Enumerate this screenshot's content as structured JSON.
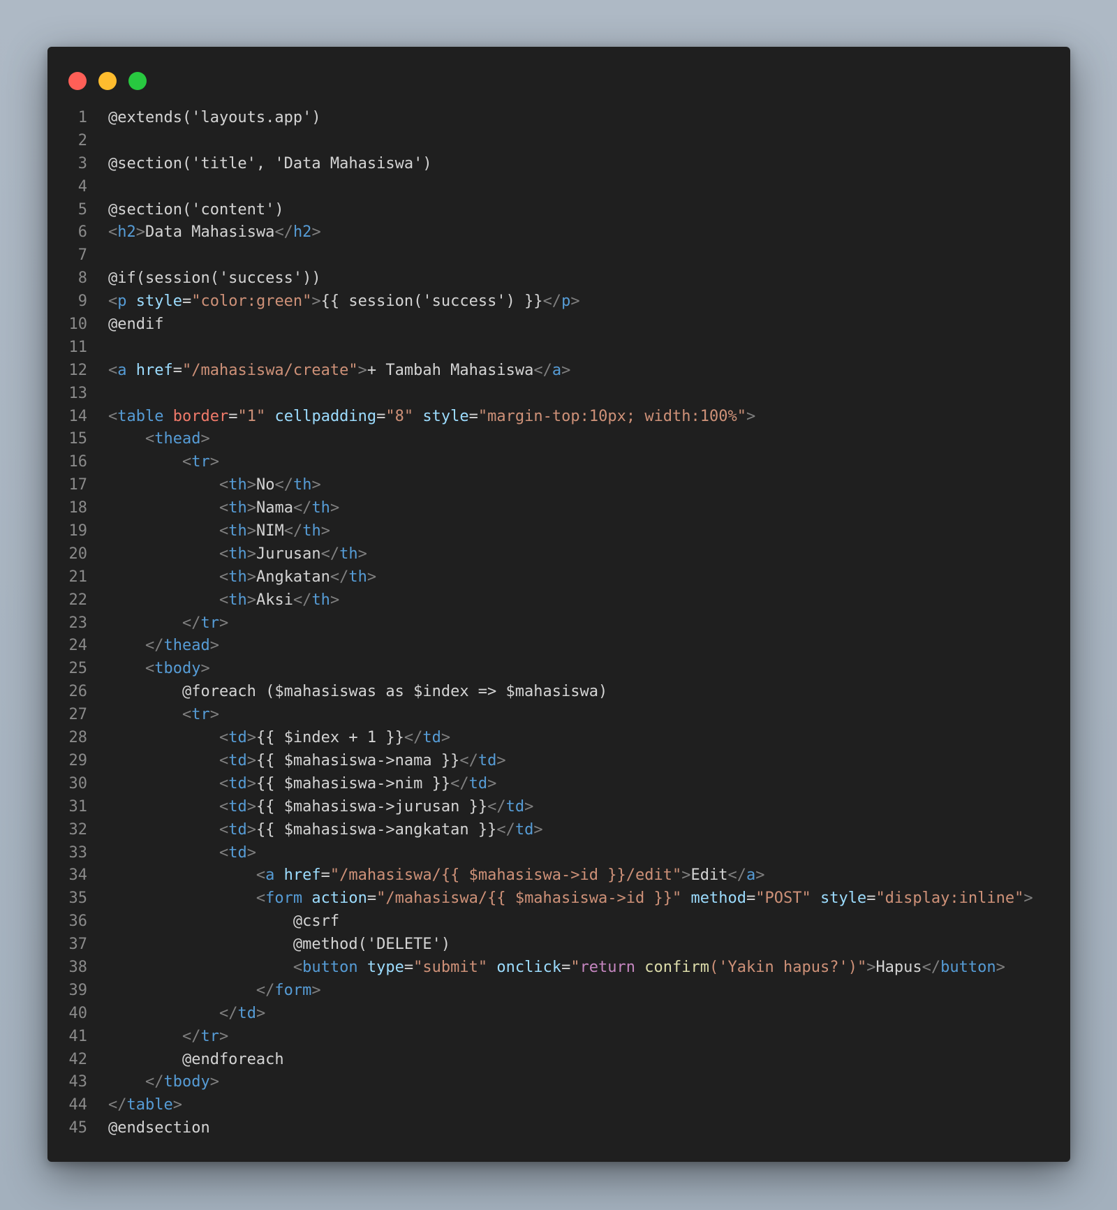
{
  "colors": {
    "background": "#a9b5c2",
    "editor_background": "#1f1f1f",
    "line_number": "#8a8a8a",
    "plain": "#d4d4d4",
    "bracket": "#808080",
    "tag": "#569cd6",
    "attribute": "#9cdcfe",
    "attribute_red": "#f07a6a",
    "string": "#ce9178",
    "keyword": "#c586c0",
    "function": "#dcdcaa",
    "close_button": "#ff5f57",
    "minimize_button": "#febc2e",
    "maximize_button": "#28c840"
  },
  "lines": [
    {
      "n": "1",
      "tokens": [
        [
          "plain",
          "@extends('layouts.app')"
        ]
      ]
    },
    {
      "n": "2",
      "tokens": []
    },
    {
      "n": "3",
      "tokens": [
        [
          "plain",
          "@section('title', 'Data Mahasiswa')"
        ]
      ]
    },
    {
      "n": "4",
      "tokens": []
    },
    {
      "n": "5",
      "tokens": [
        [
          "plain",
          "@section('content')"
        ]
      ]
    },
    {
      "n": "6",
      "tokens": [
        [
          "bracket",
          "<"
        ],
        [
          "tag",
          "h2"
        ],
        [
          "bracket",
          ">"
        ],
        [
          "plain",
          "Data Mahasiswa"
        ],
        [
          "bracket",
          "</"
        ],
        [
          "tag",
          "h2"
        ],
        [
          "bracket",
          ">"
        ]
      ]
    },
    {
      "n": "7",
      "tokens": []
    },
    {
      "n": "8",
      "tokens": [
        [
          "plain",
          "@if(session('success'))"
        ]
      ]
    },
    {
      "n": "9",
      "tokens": [
        [
          "bracket",
          "<"
        ],
        [
          "tag",
          "p"
        ],
        [
          "plain",
          " "
        ],
        [
          "attr",
          "style"
        ],
        [
          "plain",
          "="
        ],
        [
          "str",
          "\"color:green\""
        ],
        [
          "bracket",
          ">"
        ],
        [
          "plain",
          "{{ session('success') }}"
        ],
        [
          "bracket",
          "</"
        ],
        [
          "tag",
          "p"
        ],
        [
          "bracket",
          ">"
        ]
      ]
    },
    {
      "n": "10",
      "tokens": [
        [
          "plain",
          "@endif"
        ]
      ]
    },
    {
      "n": "11",
      "tokens": []
    },
    {
      "n": "12",
      "tokens": [
        [
          "bracket",
          "<"
        ],
        [
          "tag",
          "a"
        ],
        [
          "plain",
          " "
        ],
        [
          "attr",
          "href"
        ],
        [
          "plain",
          "="
        ],
        [
          "str",
          "\"/mahasiswa/create\""
        ],
        [
          "bracket",
          ">"
        ],
        [
          "plain",
          "+ Tambah Mahasiswa"
        ],
        [
          "bracket",
          "</"
        ],
        [
          "tag",
          "a"
        ],
        [
          "bracket",
          ">"
        ]
      ]
    },
    {
      "n": "13",
      "tokens": []
    },
    {
      "n": "14",
      "tokens": [
        [
          "bracket",
          "<"
        ],
        [
          "tag",
          "table"
        ],
        [
          "plain",
          " "
        ],
        [
          "attr-red",
          "border"
        ],
        [
          "plain",
          "="
        ],
        [
          "str",
          "\"1\""
        ],
        [
          "plain",
          " "
        ],
        [
          "attr",
          "cellpadding"
        ],
        [
          "plain",
          "="
        ],
        [
          "str",
          "\"8\""
        ],
        [
          "plain",
          " "
        ],
        [
          "attr",
          "style"
        ],
        [
          "plain",
          "="
        ],
        [
          "str",
          "\"margin-top:10px; width:100%\""
        ],
        [
          "bracket",
          ">"
        ]
      ]
    },
    {
      "n": "15",
      "tokens": [
        [
          "plain",
          "    "
        ],
        [
          "bracket",
          "<"
        ],
        [
          "tag",
          "thead"
        ],
        [
          "bracket",
          ">"
        ]
      ]
    },
    {
      "n": "16",
      "tokens": [
        [
          "plain",
          "        "
        ],
        [
          "bracket",
          "<"
        ],
        [
          "tag",
          "tr"
        ],
        [
          "bracket",
          ">"
        ]
      ]
    },
    {
      "n": "17",
      "tokens": [
        [
          "plain",
          "            "
        ],
        [
          "bracket",
          "<"
        ],
        [
          "tag",
          "th"
        ],
        [
          "bracket",
          ">"
        ],
        [
          "plain",
          "No"
        ],
        [
          "bracket",
          "</"
        ],
        [
          "tag",
          "th"
        ],
        [
          "bracket",
          ">"
        ]
      ]
    },
    {
      "n": "18",
      "tokens": [
        [
          "plain",
          "            "
        ],
        [
          "bracket",
          "<"
        ],
        [
          "tag",
          "th"
        ],
        [
          "bracket",
          ">"
        ],
        [
          "plain",
          "Nama"
        ],
        [
          "bracket",
          "</"
        ],
        [
          "tag",
          "th"
        ],
        [
          "bracket",
          ">"
        ]
      ]
    },
    {
      "n": "19",
      "tokens": [
        [
          "plain",
          "            "
        ],
        [
          "bracket",
          "<"
        ],
        [
          "tag",
          "th"
        ],
        [
          "bracket",
          ">"
        ],
        [
          "plain",
          "NIM"
        ],
        [
          "bracket",
          "</"
        ],
        [
          "tag",
          "th"
        ],
        [
          "bracket",
          ">"
        ]
      ]
    },
    {
      "n": "20",
      "tokens": [
        [
          "plain",
          "            "
        ],
        [
          "bracket",
          "<"
        ],
        [
          "tag",
          "th"
        ],
        [
          "bracket",
          ">"
        ],
        [
          "plain",
          "Jurusan"
        ],
        [
          "bracket",
          "</"
        ],
        [
          "tag",
          "th"
        ],
        [
          "bracket",
          ">"
        ]
      ]
    },
    {
      "n": "21",
      "tokens": [
        [
          "plain",
          "            "
        ],
        [
          "bracket",
          "<"
        ],
        [
          "tag",
          "th"
        ],
        [
          "bracket",
          ">"
        ],
        [
          "plain",
          "Angkatan"
        ],
        [
          "bracket",
          "</"
        ],
        [
          "tag",
          "th"
        ],
        [
          "bracket",
          ">"
        ]
      ]
    },
    {
      "n": "22",
      "tokens": [
        [
          "plain",
          "            "
        ],
        [
          "bracket",
          "<"
        ],
        [
          "tag",
          "th"
        ],
        [
          "bracket",
          ">"
        ],
        [
          "plain",
          "Aksi"
        ],
        [
          "bracket",
          "</"
        ],
        [
          "tag",
          "th"
        ],
        [
          "bracket",
          ">"
        ]
      ]
    },
    {
      "n": "23",
      "tokens": [
        [
          "plain",
          "        "
        ],
        [
          "bracket",
          "</"
        ],
        [
          "tag",
          "tr"
        ],
        [
          "bracket",
          ">"
        ]
      ]
    },
    {
      "n": "24",
      "tokens": [
        [
          "plain",
          "    "
        ],
        [
          "bracket",
          "</"
        ],
        [
          "tag",
          "thead"
        ],
        [
          "bracket",
          ">"
        ]
      ]
    },
    {
      "n": "25",
      "tokens": [
        [
          "plain",
          "    "
        ],
        [
          "bracket",
          "<"
        ],
        [
          "tag",
          "tbody"
        ],
        [
          "bracket",
          ">"
        ]
      ]
    },
    {
      "n": "26",
      "tokens": [
        [
          "plain",
          "        @foreach ($mahasiswas as $index => $mahasiswa)"
        ]
      ]
    },
    {
      "n": "27",
      "tokens": [
        [
          "plain",
          "        "
        ],
        [
          "bracket",
          "<"
        ],
        [
          "tag",
          "tr"
        ],
        [
          "bracket",
          ">"
        ]
      ]
    },
    {
      "n": "28",
      "tokens": [
        [
          "plain",
          "            "
        ],
        [
          "bracket",
          "<"
        ],
        [
          "tag",
          "td"
        ],
        [
          "bracket",
          ">"
        ],
        [
          "plain",
          "{{ $index + 1 }}"
        ],
        [
          "bracket",
          "</"
        ],
        [
          "tag",
          "td"
        ],
        [
          "bracket",
          ">"
        ]
      ]
    },
    {
      "n": "29",
      "tokens": [
        [
          "plain",
          "            "
        ],
        [
          "bracket",
          "<"
        ],
        [
          "tag",
          "td"
        ],
        [
          "bracket",
          ">"
        ],
        [
          "plain",
          "{{ $mahasiswa->nama }}"
        ],
        [
          "bracket",
          "</"
        ],
        [
          "tag",
          "td"
        ],
        [
          "bracket",
          ">"
        ]
      ]
    },
    {
      "n": "30",
      "tokens": [
        [
          "plain",
          "            "
        ],
        [
          "bracket",
          "<"
        ],
        [
          "tag",
          "td"
        ],
        [
          "bracket",
          ">"
        ],
        [
          "plain",
          "{{ $mahasiswa->nim }}"
        ],
        [
          "bracket",
          "</"
        ],
        [
          "tag",
          "td"
        ],
        [
          "bracket",
          ">"
        ]
      ]
    },
    {
      "n": "31",
      "tokens": [
        [
          "plain",
          "            "
        ],
        [
          "bracket",
          "<"
        ],
        [
          "tag",
          "td"
        ],
        [
          "bracket",
          ">"
        ],
        [
          "plain",
          "{{ $mahasiswa->jurusan }}"
        ],
        [
          "bracket",
          "</"
        ],
        [
          "tag",
          "td"
        ],
        [
          "bracket",
          ">"
        ]
      ]
    },
    {
      "n": "32",
      "tokens": [
        [
          "plain",
          "            "
        ],
        [
          "bracket",
          "<"
        ],
        [
          "tag",
          "td"
        ],
        [
          "bracket",
          ">"
        ],
        [
          "plain",
          "{{ $mahasiswa->angkatan }}"
        ],
        [
          "bracket",
          "</"
        ],
        [
          "tag",
          "td"
        ],
        [
          "bracket",
          ">"
        ]
      ]
    },
    {
      "n": "33",
      "tokens": [
        [
          "plain",
          "            "
        ],
        [
          "bracket",
          "<"
        ],
        [
          "tag",
          "td"
        ],
        [
          "bracket",
          ">"
        ]
      ]
    },
    {
      "n": "34",
      "tokens": [
        [
          "plain",
          "                "
        ],
        [
          "bracket",
          "<"
        ],
        [
          "tag",
          "a"
        ],
        [
          "plain",
          " "
        ],
        [
          "attr",
          "href"
        ],
        [
          "plain",
          "="
        ],
        [
          "str",
          "\"/mahasiswa/{{ $mahasiswa->id }}/edit\""
        ],
        [
          "bracket",
          ">"
        ],
        [
          "plain",
          "Edit"
        ],
        [
          "bracket",
          "</"
        ],
        [
          "tag",
          "a"
        ],
        [
          "bracket",
          ">"
        ]
      ]
    },
    {
      "n": "35",
      "tokens": [
        [
          "plain",
          "                "
        ],
        [
          "bracket",
          "<"
        ],
        [
          "tag",
          "form"
        ],
        [
          "plain",
          " "
        ],
        [
          "attr",
          "action"
        ],
        [
          "plain",
          "="
        ],
        [
          "str",
          "\"/mahasiswa/{{ $mahasiswa->id }}\""
        ],
        [
          "plain",
          " "
        ],
        [
          "attr",
          "method"
        ],
        [
          "plain",
          "="
        ],
        [
          "str",
          "\"POST\""
        ],
        [
          "plain",
          " "
        ],
        [
          "attr",
          "style"
        ],
        [
          "plain",
          "="
        ],
        [
          "str",
          "\"display:inline\""
        ],
        [
          "bracket",
          ">"
        ]
      ]
    },
    {
      "n": "36",
      "tokens": [
        [
          "plain",
          "                    @csrf"
        ]
      ]
    },
    {
      "n": "37",
      "tokens": [
        [
          "plain",
          "                    @method('DELETE')"
        ]
      ]
    },
    {
      "n": "38",
      "tokens": [
        [
          "plain",
          "                    "
        ],
        [
          "bracket",
          "<"
        ],
        [
          "tag",
          "button"
        ],
        [
          "plain",
          " "
        ],
        [
          "attr",
          "type"
        ],
        [
          "plain",
          "="
        ],
        [
          "str",
          "\"submit\""
        ],
        [
          "plain",
          " "
        ],
        [
          "attr",
          "onclick"
        ],
        [
          "plain",
          "="
        ],
        [
          "str",
          "\""
        ],
        [
          "kw",
          "return"
        ],
        [
          "plain",
          " "
        ],
        [
          "fn",
          "confirm"
        ],
        [
          "str",
          "('Yakin hapus?')\""
        ],
        [
          "bracket",
          ">"
        ],
        [
          "plain",
          "Hapus"
        ],
        [
          "bracket",
          "</"
        ],
        [
          "tag",
          "button"
        ],
        [
          "bracket",
          ">"
        ]
      ]
    },
    {
      "n": "39",
      "tokens": [
        [
          "plain",
          "                "
        ],
        [
          "bracket",
          "</"
        ],
        [
          "tag",
          "form"
        ],
        [
          "bracket",
          ">"
        ]
      ]
    },
    {
      "n": "40",
      "tokens": [
        [
          "plain",
          "            "
        ],
        [
          "bracket",
          "</"
        ],
        [
          "tag",
          "td"
        ],
        [
          "bracket",
          ">"
        ]
      ]
    },
    {
      "n": "41",
      "tokens": [
        [
          "plain",
          "        "
        ],
        [
          "bracket",
          "</"
        ],
        [
          "tag",
          "tr"
        ],
        [
          "bracket",
          ">"
        ]
      ]
    },
    {
      "n": "42",
      "tokens": [
        [
          "plain",
          "        @endforeach"
        ]
      ]
    },
    {
      "n": "43",
      "tokens": [
        [
          "plain",
          "    "
        ],
        [
          "bracket",
          "</"
        ],
        [
          "tag",
          "tbody"
        ],
        [
          "bracket",
          ">"
        ]
      ]
    },
    {
      "n": "44",
      "tokens": [
        [
          "bracket",
          "</"
        ],
        [
          "tag",
          "table"
        ],
        [
          "bracket",
          ">"
        ]
      ]
    },
    {
      "n": "45",
      "tokens": [
        [
          "plain",
          "@endsection"
        ]
      ]
    }
  ]
}
